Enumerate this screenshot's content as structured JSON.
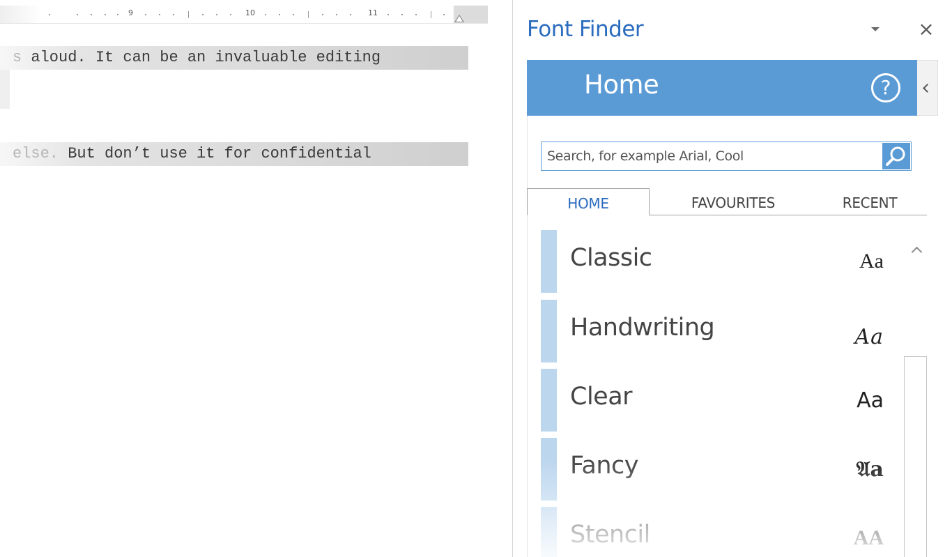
{
  "document": {
    "ruler": {
      "numbers": [
        "9",
        "10",
        "11"
      ]
    },
    "line1": {
      "faded": "s",
      "text": " aloud. It can be an invaluable editing"
    },
    "line2": {
      "faded": "else.",
      "text": " But don’t use it for confidential"
    }
  },
  "pane": {
    "title": "Font Finder",
    "close_glyph": "×",
    "home": {
      "title": "Home",
      "help_glyph": "?"
    },
    "search": {
      "placeholder": "Search, for example Arial, Cool"
    },
    "tabs": [
      {
        "label": "HOME",
        "active": true
      },
      {
        "label": "FAVOURITES",
        "active": false
      },
      {
        "label": "RECENT",
        "active": false
      }
    ],
    "categories": [
      {
        "label": "Classic",
        "sample": "Aa"
      },
      {
        "label": "Handwriting",
        "sample": "Aa"
      },
      {
        "label": "Clear",
        "sample": "Aa"
      },
      {
        "label": "Fancy",
        "sample": "𝔄a"
      },
      {
        "label": "Stencil",
        "sample": "AA"
      }
    ],
    "icons": {
      "menu": "dropdown-triangle-icon",
      "close": "close-icon",
      "help": "help-circle-icon",
      "collapse": "chevron-left-icon",
      "search": "magnifier-icon",
      "scroll_up": "chevron-up-icon"
    },
    "colors": {
      "accent": "#5b9bd5",
      "title": "#2b6cbf",
      "stripe": "#bcd6ee"
    }
  }
}
